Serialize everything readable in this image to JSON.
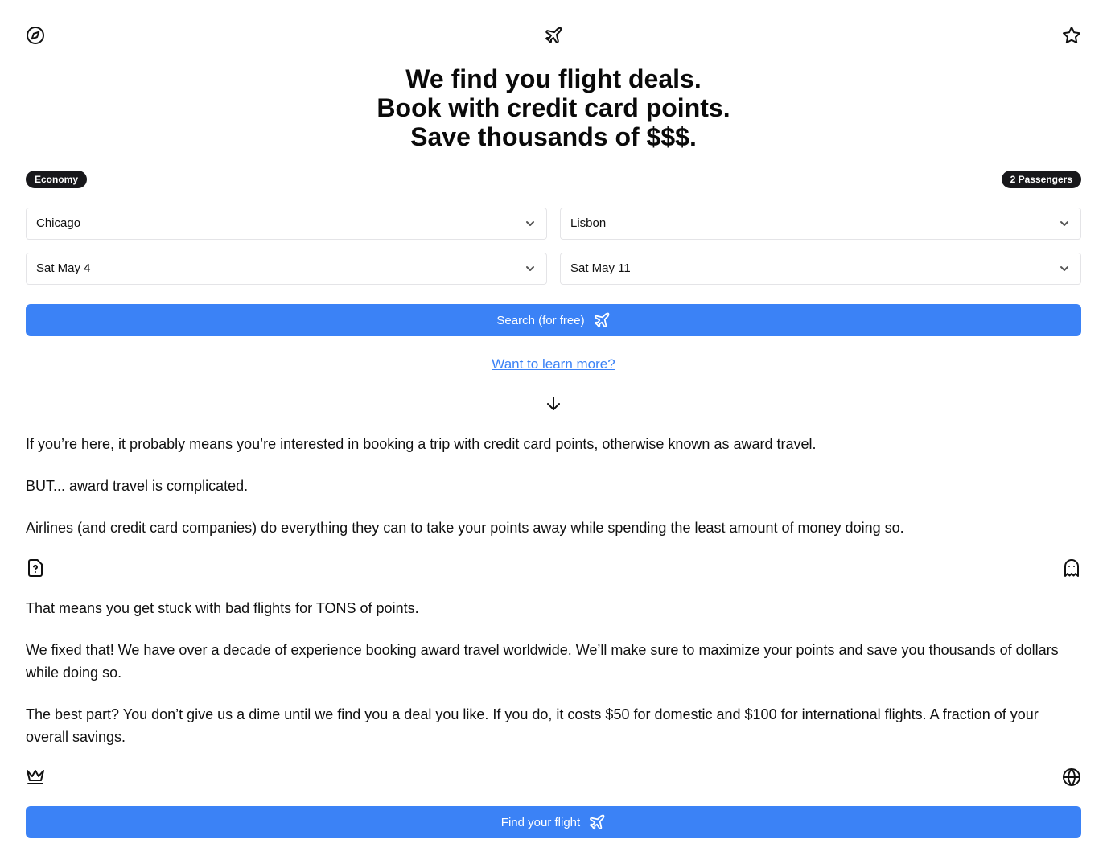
{
  "header": {
    "left_icon": "compass-icon",
    "center_icon": "plane-icon",
    "right_icon": "star-icon"
  },
  "hero": {
    "line1": "We find you flight deals.",
    "line2": "Book with credit card points.",
    "line3": "Save thousands of $$$."
  },
  "search": {
    "cabin_badge": "Economy",
    "passengers_badge": "2 Passengers",
    "origin": "Chicago",
    "destination": "Lisbon",
    "depart_date": "Sat May 4",
    "return_date": "Sat May 11",
    "search_button_label": "Search (for free)"
  },
  "learn_more": {
    "link_text": "Want to learn more?",
    "scroll_icon": "arrow-down-icon"
  },
  "content": {
    "p1": "If you’re here, it probably means you’re interested in booking a trip with credit card points, otherwise known as award travel.",
    "p2": "BUT... award travel is complicated.",
    "p3": "Airlines (and credit card companies) do everything they can to take your points away while spending the least amount of money doing so.",
    "divider1_left_icon": "file-question-icon",
    "divider1_right_icon": "ghost-icon",
    "p4": "That means you get stuck with bad flights for TONS of points.",
    "p5": "We fixed that! We have over a decade of experience booking award travel worldwide. We’ll make sure to maximize your points and save you thousands of dollars while doing so.",
    "p6": "The best part? You don’t give us a dime until we find you a deal you like. If you do, it costs $50 for domestic and $100 for international flights. A fraction of your overall savings.",
    "divider2_left_icon": "crown-icon",
    "divider2_right_icon": "globe-icon"
  },
  "cta": {
    "find_button_label": "Find your flight"
  },
  "colors": {
    "accent": "#3b82f6",
    "badge_bg": "#18181b",
    "text": "#111111"
  }
}
